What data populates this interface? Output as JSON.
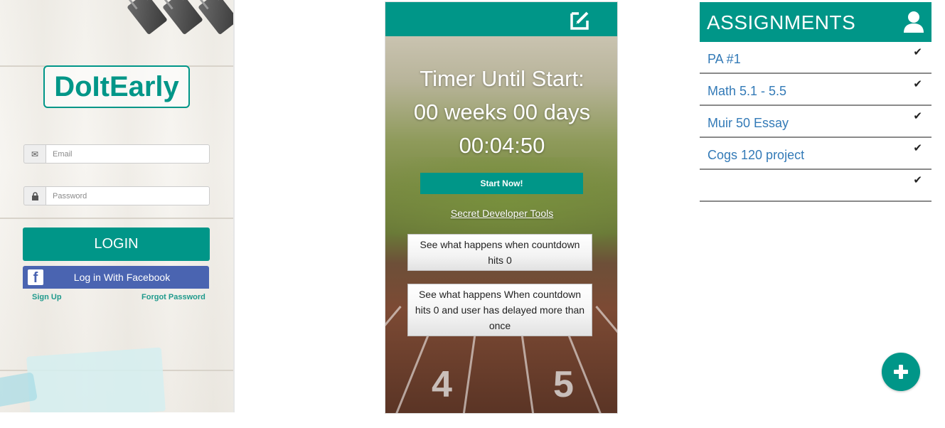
{
  "login": {
    "logo_text": "DoItEarly",
    "email_placeholder": "Email",
    "password_placeholder": "Password",
    "login_label": "LOGIN",
    "facebook_label": "Log in With Facebook",
    "signup_label": "Sign Up",
    "forgot_label": "Forgot Password",
    "icons": {
      "email": "envelope-icon",
      "password": "lock-icon",
      "facebook": "facebook-icon"
    }
  },
  "timer": {
    "title_line1": "Timer Until Start:",
    "countdown_weeks_days": "00 weeks 00 days",
    "countdown_time": "00:04:50",
    "start_label": "Start Now!",
    "dev_tools_label": "Secret Developer Tools",
    "dev_button_1": "See what happens when countdown hits 0",
    "dev_button_2": "See what happens When countdown hits 0 and user has delayed more than once",
    "lane_numbers": [
      "4",
      "5"
    ],
    "icons": {
      "header": "edit-icon"
    }
  },
  "assignments": {
    "title": "ASSIGNMENTS",
    "items": [
      {
        "name": "PA #1"
      },
      {
        "name": "Math 5.1 - 5.5"
      },
      {
        "name": "Muir 50 Essay"
      },
      {
        "name": "Cogs 120 project"
      },
      {
        "name": ""
      }
    ],
    "check_glyph": "✔",
    "icons": {
      "header": "user-icon",
      "fab": "plus-icon",
      "row": "check-icon"
    }
  },
  "colors": {
    "accent": "#009688",
    "facebook": "#4a64b1",
    "link": "#337ab7"
  }
}
